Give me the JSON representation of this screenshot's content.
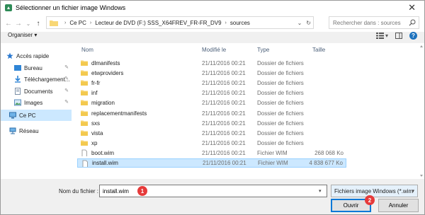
{
  "window": {
    "title": "Sélectionner un fichier image Windows",
    "close_glyph": "✕"
  },
  "nav": {
    "back": "←",
    "forward": "→",
    "recent": "⌄",
    "up": "↑"
  },
  "address": {
    "breadcrumbs": [
      "Ce PC",
      "Lecteur de DVD (F:) SSS_X64FREV_FR-FR_DV9",
      "sources"
    ],
    "separator": "›",
    "dropdown": "⌄",
    "refresh": "↻"
  },
  "search": {
    "placeholder": "Rechercher dans : sources"
  },
  "toolbar": {
    "organiser": "Organiser ▾",
    "view_menu": "▾",
    "help": "?"
  },
  "sidebar": {
    "items": [
      {
        "label": "Accès rapide",
        "icon": "star-icon",
        "pinned": false
      },
      {
        "label": "Bureau",
        "icon": "desktop-folder-icon",
        "pinned": true
      },
      {
        "label": "Téléchargement...",
        "icon": "download-icon",
        "pinned": true
      },
      {
        "label": "Documents",
        "icon": "documents-icon",
        "pinned": true
      },
      {
        "label": "Images",
        "icon": "pictures-icon",
        "pinned": true
      },
      {
        "label": "Ce PC",
        "icon": "computer-icon",
        "pinned": false,
        "selected": true
      },
      {
        "label": "Réseau",
        "icon": "network-icon",
        "pinned": false
      }
    ]
  },
  "columns": {
    "name": "Nom",
    "modified": "Modifié le",
    "type": "Type",
    "size": "Taille"
  },
  "files": [
    {
      "name": "dlmanifests",
      "date": "21/11/2016 00:21",
      "type": "Dossier de fichiers",
      "size": "",
      "kind": "folder"
    },
    {
      "name": "etwproviders",
      "date": "21/11/2016 00:21",
      "type": "Dossier de fichiers",
      "size": "",
      "kind": "folder"
    },
    {
      "name": "fr-fr",
      "date": "21/11/2016 00:21",
      "type": "Dossier de fichiers",
      "size": "",
      "kind": "folder"
    },
    {
      "name": "inf",
      "date": "21/11/2016 00:21",
      "type": "Dossier de fichiers",
      "size": "",
      "kind": "folder"
    },
    {
      "name": "migration",
      "date": "21/11/2016 00:21",
      "type": "Dossier de fichiers",
      "size": "",
      "kind": "folder"
    },
    {
      "name": "replacementmanifests",
      "date": "21/11/2016 00:21",
      "type": "Dossier de fichiers",
      "size": "",
      "kind": "folder"
    },
    {
      "name": "sxs",
      "date": "21/11/2016 00:21",
      "type": "Dossier de fichiers",
      "size": "",
      "kind": "folder"
    },
    {
      "name": "vista",
      "date": "21/11/2016 00:21",
      "type": "Dossier de fichiers",
      "size": "",
      "kind": "folder"
    },
    {
      "name": "xp",
      "date": "21/11/2016 00:21",
      "type": "Dossier de fichiers",
      "size": "",
      "kind": "folder"
    },
    {
      "name": "boot.wim",
      "date": "21/11/2016 00:21",
      "type": "Fichier WIM",
      "size": "268 068 Ko",
      "kind": "file"
    },
    {
      "name": "install.wim",
      "date": "21/11/2016 00:21",
      "type": "Fichier WIM",
      "size": "4 838 677 Ko",
      "kind": "file",
      "selected": true
    }
  ],
  "footer": {
    "filename_label": "Nom du fichier :",
    "filename_value": "install.wim",
    "filter_label": "Fichiers image Windows (*.wim",
    "open_label": "Ouvrir",
    "cancel_label": "Annuler",
    "badge1": "1",
    "badge2": "2"
  },
  "colors": {
    "accent": "#0078d7",
    "selection": "#cce8ff",
    "folder": "#f8d775",
    "badge": "#e63b3b"
  }
}
